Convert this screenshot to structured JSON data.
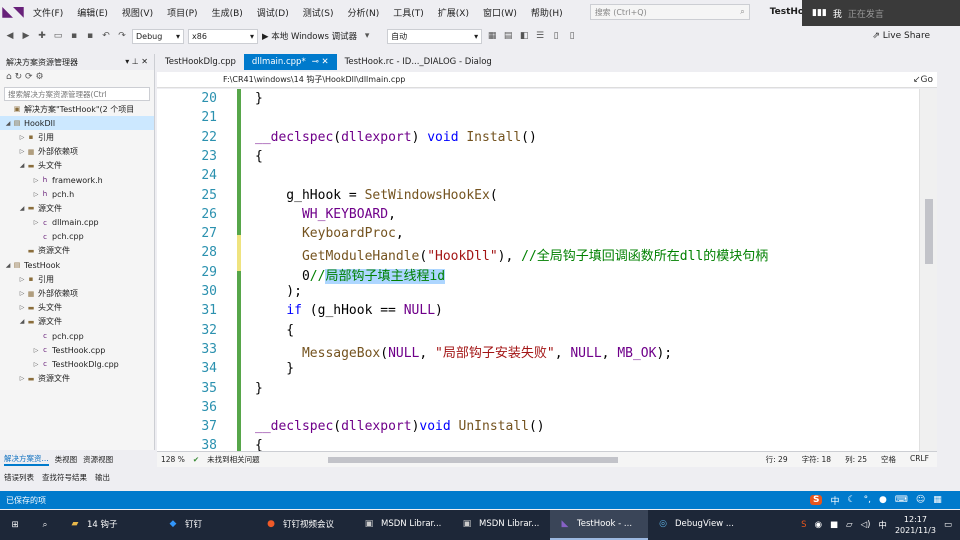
{
  "menubar": {
    "items": [
      "文件(F)",
      "编辑(E)",
      "视图(V)",
      "项目(P)",
      "生成(B)",
      "调试(D)",
      "测试(S)",
      "分析(N)",
      "工具(T)",
      "扩展(X)",
      "窗口(W)",
      "帮助(H)"
    ],
    "search_placeholder": "搜索 (Ctrl+Q)",
    "window_title": "TestHook"
  },
  "overlay": {
    "user": "我",
    "status": "正在发言"
  },
  "toolbar": {
    "config": "Debug",
    "platform": "x86",
    "run_label": "▶ 本地 Windows 调试器",
    "auto": "自动",
    "live_share": "Live Share"
  },
  "solution": {
    "title": "解决方案资源管理器",
    "search_placeholder": "搜索解决方案资源管理器(Ctrl",
    "items": [
      {
        "label": "解决方案\"TestHook\"(2 个项目",
        "indent": 0,
        "twisty": "",
        "icon": "▣"
      },
      {
        "label": "HookDll",
        "indent": 0,
        "twisty": "◢",
        "icon": "▤",
        "selected": true
      },
      {
        "label": "引用",
        "indent": 1,
        "twisty": "▷",
        "icon": "▪"
      },
      {
        "label": "外部依赖项",
        "indent": 1,
        "twisty": "▷",
        "icon": "▦"
      },
      {
        "label": "头文件",
        "indent": 1,
        "twisty": "◢",
        "icon": "▬"
      },
      {
        "label": "framework.h",
        "indent": 2,
        "twisty": "▷",
        "icon": "h"
      },
      {
        "label": "pch.h",
        "indent": 2,
        "twisty": "▷",
        "icon": "h"
      },
      {
        "label": "源文件",
        "indent": 1,
        "twisty": "◢",
        "icon": "▬"
      },
      {
        "label": "dllmain.cpp",
        "indent": 2,
        "twisty": "▷",
        "icon": "c"
      },
      {
        "label": "pch.cpp",
        "indent": 2,
        "twisty": "",
        "icon": "c"
      },
      {
        "label": "资源文件",
        "indent": 1,
        "twisty": "",
        "icon": "▬"
      },
      {
        "label": "TestHook",
        "indent": 0,
        "twisty": "◢",
        "icon": "▤"
      },
      {
        "label": "引用",
        "indent": 1,
        "twisty": "▷",
        "icon": "▪"
      },
      {
        "label": "外部依赖项",
        "indent": 1,
        "twisty": "▷",
        "icon": "▦"
      },
      {
        "label": "头文件",
        "indent": 1,
        "twisty": "▷",
        "icon": "▬"
      },
      {
        "label": "源文件",
        "indent": 1,
        "twisty": "◢",
        "icon": "▬"
      },
      {
        "label": "pch.cpp",
        "indent": 2,
        "twisty": "",
        "icon": "c"
      },
      {
        "label": "TestHook.cpp",
        "indent": 2,
        "twisty": "▷",
        "icon": "c"
      },
      {
        "label": "TestHookDlg.cpp",
        "indent": 2,
        "twisty": "▷",
        "icon": "c"
      },
      {
        "label": "资源文件",
        "indent": 1,
        "twisty": "▷",
        "icon": "▬"
      }
    ]
  },
  "tabs": [
    {
      "label": "TestHookDlg.cpp",
      "active": false
    },
    {
      "label": "dllmain.cpp*",
      "active": true
    },
    {
      "label": "TestHook.rc - ID..._DIALOG - Dialog",
      "active": false
    }
  ],
  "path": "F:\\CR41\\windows\\14 钩子\\HookDll\\dllmain.cpp",
  "path_go": "Go",
  "code_lines": [
    {
      "n": "20",
      "t": "}"
    },
    {
      "n": "21",
      "t": ""
    },
    {
      "n": "22",
      "t": "__declspec(dllexport) void Install()"
    },
    {
      "n": "23",
      "t": "{"
    },
    {
      "n": "24",
      "t": ""
    },
    {
      "n": "25",
      "t": "    g_hHook = SetWindowsHookEx("
    },
    {
      "n": "26",
      "t": "      WH_KEYBOARD,"
    },
    {
      "n": "27",
      "t": "      KeyboardProc,"
    },
    {
      "n": "28",
      "t": "      GetModuleHandle(\"HookDll\"), //全局钩子填回调函数所在dll的模块句柄"
    },
    {
      "n": "29",
      "t": "      0//局部钩子填主线程id"
    },
    {
      "n": "30",
      "t": "    );"
    },
    {
      "n": "31",
      "t": "    if (g_hHook == NULL)"
    },
    {
      "n": "32",
      "t": "    {"
    },
    {
      "n": "33",
      "t": "      MessageBox(NULL, \"局部钩子安装失败\", NULL, MB_OK);"
    },
    {
      "n": "34",
      "t": "    }"
    },
    {
      "n": "35",
      "t": "}"
    },
    {
      "n": "36",
      "t": ""
    },
    {
      "n": "37",
      "t": "__declspec(dllexport)void UnInstall()"
    },
    {
      "n": "38",
      "t": "{"
    }
  ],
  "editor_status": {
    "zoom": "128 %",
    "issues": "未找到相关问题",
    "row": "行: 29",
    "char": "字符: 18",
    "col": "列: 25",
    "tabs": "空格",
    "eol": "CRLF"
  },
  "left_tabs": [
    "解决方案资...",
    "类视图",
    "资源视图"
  ],
  "output_tabs": [
    "错误列表",
    "查找符号结果",
    "输出"
  ],
  "status_bar": "已保存的项",
  "taskbar": {
    "tasks": [
      {
        "label": "14 钩子",
        "icon": "folder"
      },
      {
        "label": "钉钉",
        "icon": "dingtalk"
      },
      {
        "label": "钉钉视频会议",
        "icon": "video"
      },
      {
        "label": "MSDN Librar...",
        "icon": "msdn"
      },
      {
        "label": "MSDN Librar...",
        "icon": "msdn"
      },
      {
        "label": "TestHook - ...",
        "icon": "vs",
        "active": true
      },
      {
        "label": "DebugView ...",
        "icon": "debugview"
      }
    ],
    "time": "12:17",
    "date": "2021/11/3",
    "ime_lang": "中"
  }
}
